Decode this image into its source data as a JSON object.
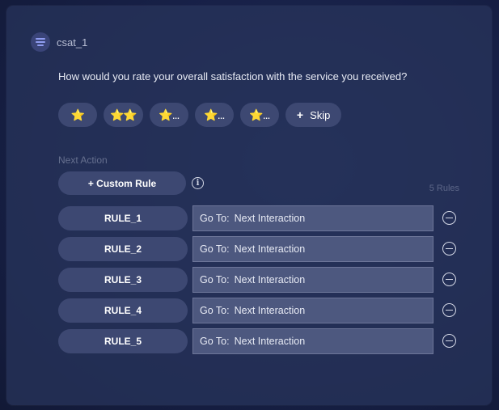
{
  "node": {
    "title": "csat_1",
    "icon": "list-lines-icon"
  },
  "question": "How would you rate your overall satisfaction with the service you received?",
  "options": [
    {
      "label": "⭐"
    },
    {
      "label": "⭐⭐"
    },
    {
      "label": "⭐..."
    },
    {
      "label": "⭐..."
    },
    {
      "label": "⭐..."
    }
  ],
  "skip": {
    "icon_text": "+",
    "label": "Skip"
  },
  "next_action": {
    "heading": "Next Action",
    "custom_rule_label": "+ Custom Rule",
    "info_icon_text": "i",
    "rule_count": "5 Rules"
  },
  "rules": [
    {
      "name": "RULE_1",
      "goto_label": "Go To:",
      "goto_value": "Next Interaction"
    },
    {
      "name": "RULE_2",
      "goto_label": "Go To:",
      "goto_value": "Next Interaction"
    },
    {
      "name": "RULE_3",
      "goto_label": "Go To:",
      "goto_value": "Next Interaction"
    },
    {
      "name": "RULE_4",
      "goto_label": "Go To:",
      "goto_value": "Next Interaction"
    },
    {
      "name": "RULE_5",
      "goto_label": "Go To:",
      "goto_value": "Next Interaction"
    }
  ],
  "colors": {
    "background": "#141c3a",
    "card": "#28345c",
    "pill": "#3d4872",
    "field": "#4d587f",
    "accent_icon": "#8f9cf0"
  }
}
